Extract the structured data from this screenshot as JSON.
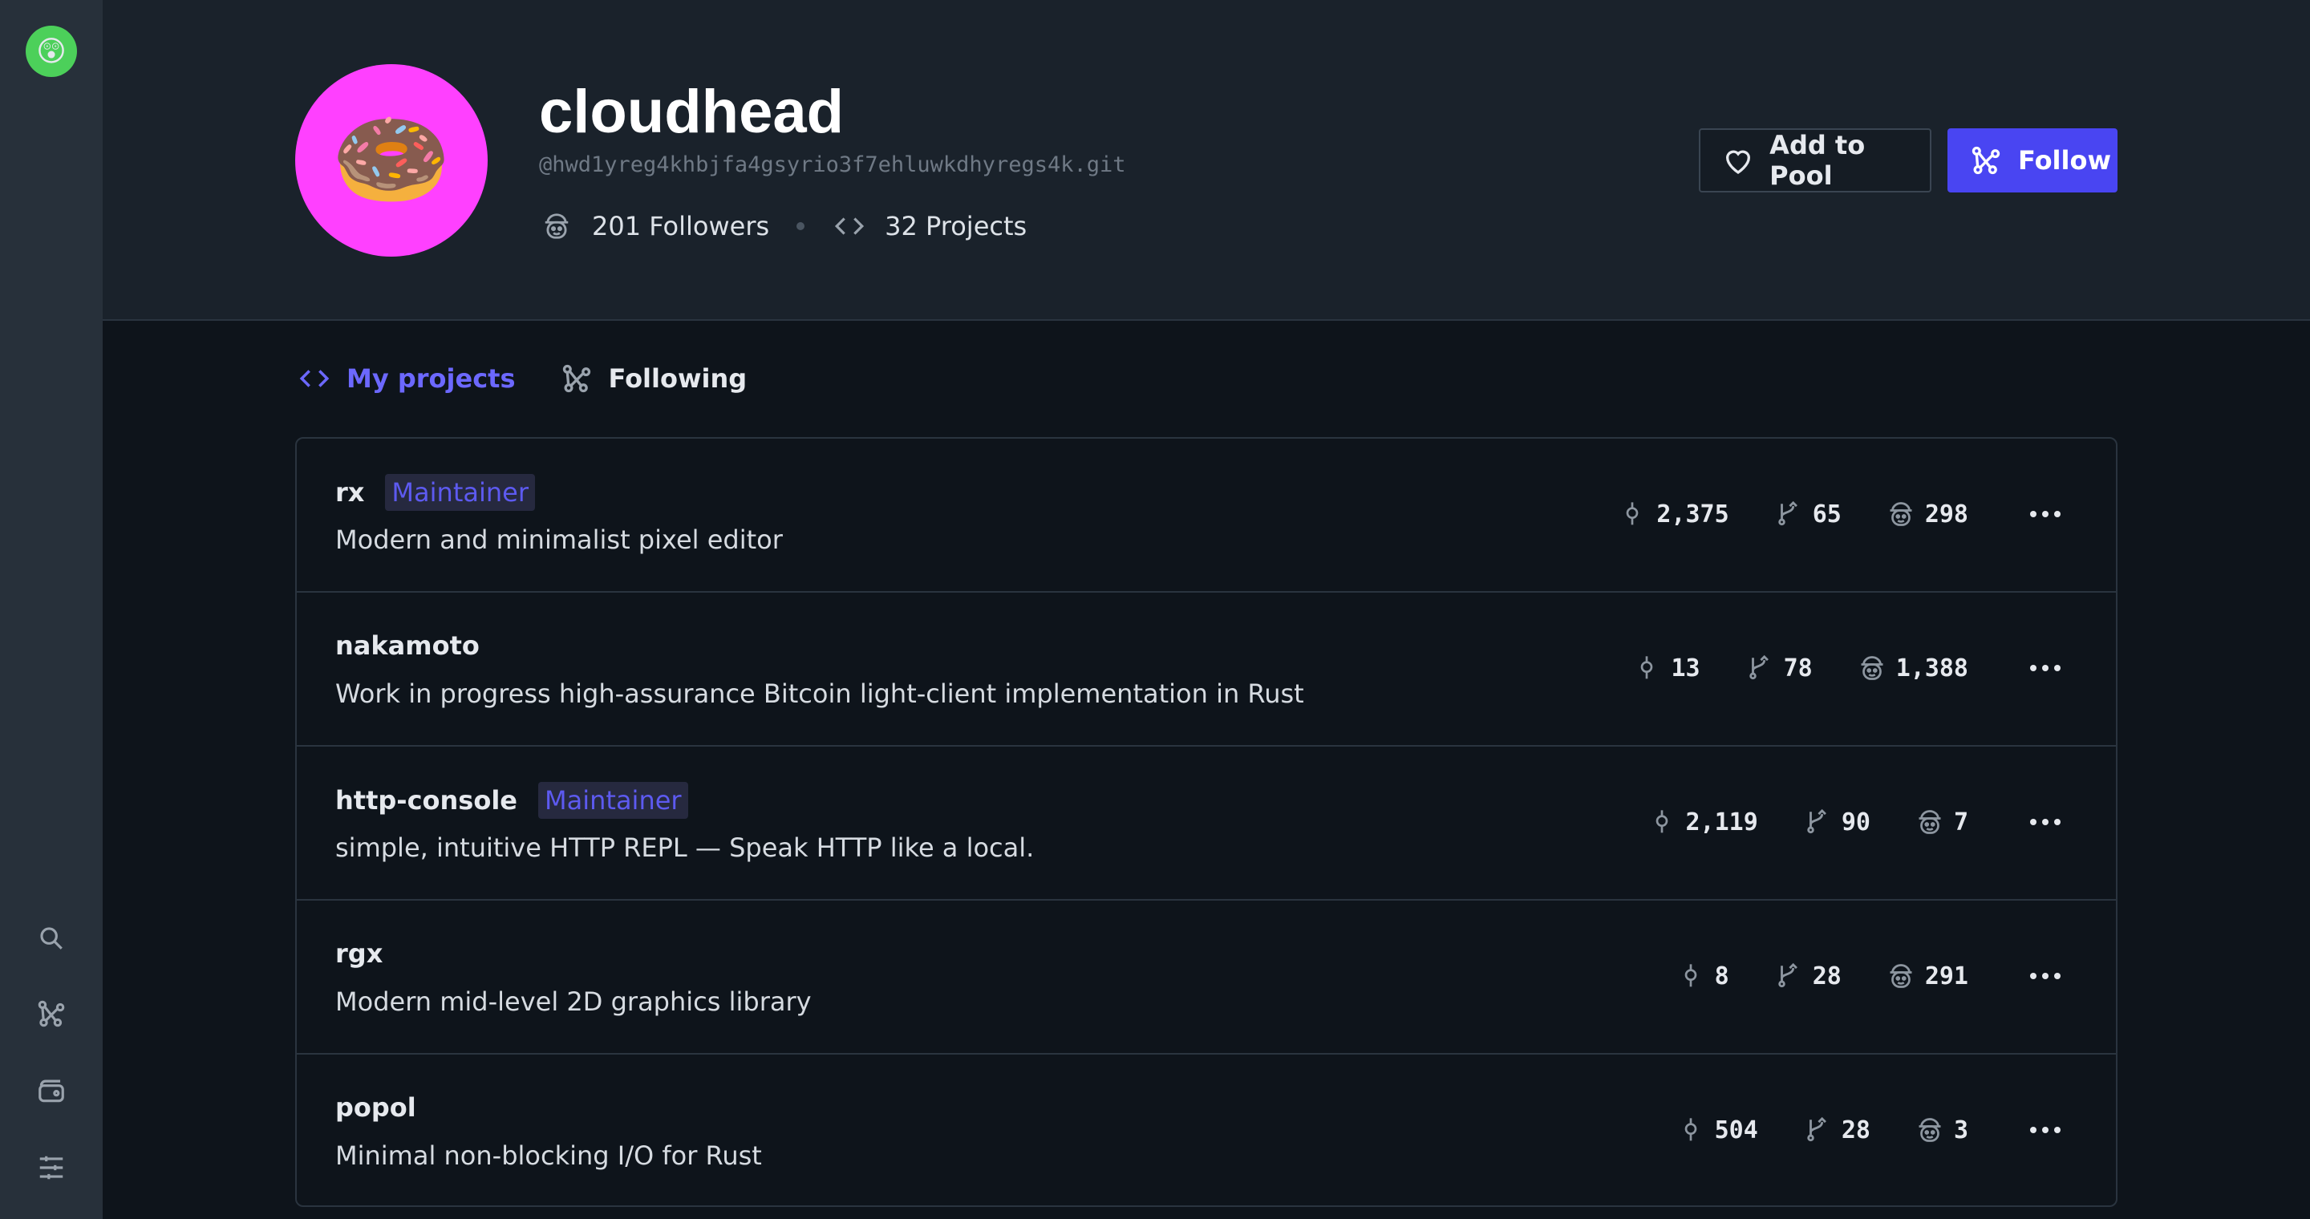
{
  "profile": {
    "name": "cloudhead",
    "handle": "@hwd1yreg4khbjfa4gsyrio3f7ehluwkdhyregs4k.git",
    "followers": "201 Followers",
    "projects": "32 Projects",
    "avatar_emoji": "🍩",
    "avatar_color": "#ff40ff"
  },
  "sidebar": {
    "avatar_emoji": "😲",
    "avatar_color": "#4cd05a",
    "icons": [
      "search-icon",
      "network-icon",
      "wallet-icon",
      "settings-sliders-icon"
    ]
  },
  "actions": {
    "add_to_pool": "Add to Pool",
    "follow": "Follow",
    "accent": "#4945f2"
  },
  "tabs": [
    {
      "label": "My projects",
      "active": true,
      "icon": "code-icon"
    },
    {
      "label": "Following",
      "active": false,
      "icon": "network-icon"
    }
  ],
  "projects": [
    {
      "name": "rx",
      "badge": "Maintainer",
      "description": "Modern and minimalist pixel editor",
      "commits": "2,375",
      "branches": "65",
      "contributors": "298"
    },
    {
      "name": "nakamoto",
      "badge": "",
      "description": "Work in progress high-assurance Bitcoin light-client implementation in Rust",
      "commits": "13",
      "branches": "78",
      "contributors": "1,388"
    },
    {
      "name": "http-console",
      "badge": "Maintainer",
      "description": "simple, intuitive HTTP REPL — Speak HTTP like a local.",
      "commits": "2,119",
      "branches": "90",
      "contributors": "7"
    },
    {
      "name": "rgx",
      "badge": "",
      "description": "Modern mid-level 2D graphics library",
      "commits": "8",
      "branches": "28",
      "contributors": "291"
    },
    {
      "name": "popol",
      "badge": "",
      "description": "Minimal non-blocking I/O for Rust",
      "commits": "504",
      "branches": "28",
      "contributors": "3"
    }
  ]
}
